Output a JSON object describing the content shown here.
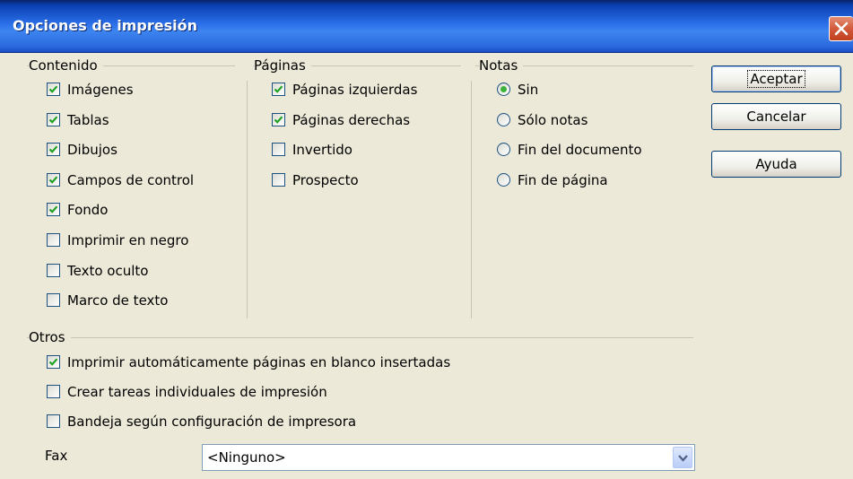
{
  "window": {
    "title": "Opciones de impresión"
  },
  "contenido": {
    "label": "Contenido",
    "items": [
      {
        "label": "Imágenes",
        "checked": true
      },
      {
        "label": "Tablas",
        "checked": true
      },
      {
        "label": "Dibujos",
        "checked": true
      },
      {
        "label": "Campos de control",
        "checked": true
      },
      {
        "label": "Fondo",
        "checked": true
      },
      {
        "label": "Imprimir en negro",
        "checked": false
      },
      {
        "label": "Texto oculto",
        "checked": false
      },
      {
        "label": "Marco de texto",
        "checked": false
      }
    ]
  },
  "paginas": {
    "label": "Páginas",
    "items": [
      {
        "label": "Páginas izquierdas",
        "checked": true
      },
      {
        "label": "Páginas derechas",
        "checked": true
      },
      {
        "label": "Invertido",
        "checked": false
      },
      {
        "label": "Prospecto",
        "checked": false
      }
    ]
  },
  "notas": {
    "label": "Notas",
    "options": [
      {
        "label": "Sin",
        "selected": true
      },
      {
        "label": "Sólo notas",
        "selected": false
      },
      {
        "label": "Fin del documento",
        "selected": false
      },
      {
        "label": "Fin de página",
        "selected": false
      }
    ]
  },
  "otros": {
    "label": "Otros",
    "items": [
      {
        "label": "Imprimir automáticamente páginas en blanco insertadas",
        "checked": true
      },
      {
        "label": "Crear tareas individuales de impresión",
        "checked": false
      },
      {
        "label": "Bandeja según configuración de impresora",
        "checked": false
      }
    ],
    "fax_label": "Fax",
    "fax_value": "<Ninguno>"
  },
  "buttons": {
    "ok": "Aceptar",
    "cancel": "Cancelar",
    "help": "Ayuda"
  },
  "colors": {
    "check": "#21a121",
    "radio": "#3bb33b",
    "titlebar": "#2a6ee8",
    "close": "#d35a3b"
  }
}
